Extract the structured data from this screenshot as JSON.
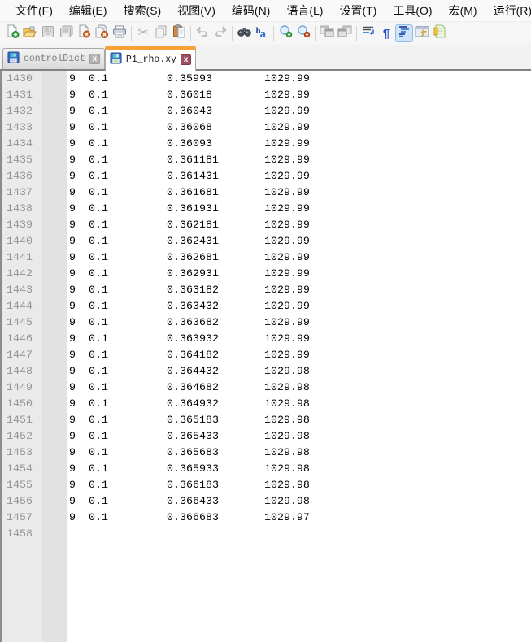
{
  "menu": {
    "items": [
      "文件(F)",
      "编辑(E)",
      "搜索(S)",
      "视图(V)",
      "编码(N)",
      "语言(L)",
      "设置(T)",
      "工具(O)",
      "宏(M)",
      "运行(R)"
    ]
  },
  "toolbar": {
    "icons": [
      {
        "name": "new-file-icon",
        "enabled": true
      },
      {
        "name": "open-file-icon",
        "enabled": true
      },
      {
        "name": "save-icon",
        "enabled": false
      },
      {
        "name": "save-all-icon",
        "enabled": false
      },
      {
        "name": "close-file-icon",
        "enabled": true
      },
      {
        "name": "close-all-icon",
        "enabled": true
      },
      {
        "name": "print-icon",
        "enabled": true
      },
      {
        "name": "cut-icon",
        "enabled": false
      },
      {
        "name": "copy-icon",
        "enabled": false
      },
      {
        "name": "paste-icon",
        "enabled": true
      },
      {
        "name": "undo-icon",
        "enabled": false
      },
      {
        "name": "redo-icon",
        "enabled": false
      },
      {
        "name": "find-icon",
        "enabled": true
      },
      {
        "name": "replace-icon",
        "enabled": true
      },
      {
        "name": "zoom-in-icon",
        "enabled": true
      },
      {
        "name": "zoom-out-icon",
        "enabled": true
      },
      {
        "name": "sync-vertical-scroll-icon",
        "enabled": false
      },
      {
        "name": "sync-horizontal-scroll-icon",
        "enabled": false
      },
      {
        "name": "word-wrap-icon",
        "enabled": true
      },
      {
        "name": "show-all-characters-icon",
        "enabled": true
      },
      {
        "name": "show-indent-guide-icon",
        "enabled": true,
        "active": true
      },
      {
        "name": "user-defined-dialog-icon",
        "enabled": true
      },
      {
        "name": "document-map-icon",
        "enabled": true,
        "clipped": true
      }
    ],
    "pilcrow_glyph": "¶",
    "cut_glyph": "✂",
    "replace_glyph_small": "h",
    "replace_glyph_big": "a"
  },
  "tabs": [
    {
      "title": "controlDict",
      "active": false,
      "saved": true,
      "close_label": "x"
    },
    {
      "title": "P1_rho.xy",
      "active": true,
      "saved": true,
      "close_label": "x"
    }
  ],
  "colors": {
    "active_tab_accent": "#f9a233",
    "active_close_bg": "#9e4f63",
    "inactive_close_bg": "#b5b5b5",
    "toolbar_active_bg": "#cfe5f7",
    "gutter_bg": "#eaeaea",
    "line_number_color": "#949494"
  },
  "editor": {
    "lines": [
      {
        "n": "1430",
        "c": [
          "9",
          "0.1",
          "0.35993",
          "1029.99"
        ]
      },
      {
        "n": "1431",
        "c": [
          "9",
          "0.1",
          "0.36018",
          "1029.99"
        ]
      },
      {
        "n": "1432",
        "c": [
          "9",
          "0.1",
          "0.36043",
          "1029.99"
        ]
      },
      {
        "n": "1433",
        "c": [
          "9",
          "0.1",
          "0.36068",
          "1029.99"
        ]
      },
      {
        "n": "1434",
        "c": [
          "9",
          "0.1",
          "0.36093",
          "1029.99"
        ]
      },
      {
        "n": "1435",
        "c": [
          "9",
          "0.1",
          "0.361181",
          "1029.99"
        ]
      },
      {
        "n": "1436",
        "c": [
          "9",
          "0.1",
          "0.361431",
          "1029.99"
        ]
      },
      {
        "n": "1437",
        "c": [
          "9",
          "0.1",
          "0.361681",
          "1029.99"
        ]
      },
      {
        "n": "1438",
        "c": [
          "9",
          "0.1",
          "0.361931",
          "1029.99"
        ]
      },
      {
        "n": "1439",
        "c": [
          "9",
          "0.1",
          "0.362181",
          "1029.99"
        ]
      },
      {
        "n": "1440",
        "c": [
          "9",
          "0.1",
          "0.362431",
          "1029.99"
        ]
      },
      {
        "n": "1441",
        "c": [
          "9",
          "0.1",
          "0.362681",
          "1029.99"
        ]
      },
      {
        "n": "1442",
        "c": [
          "9",
          "0.1",
          "0.362931",
          "1029.99"
        ]
      },
      {
        "n": "1443",
        "c": [
          "9",
          "0.1",
          "0.363182",
          "1029.99"
        ]
      },
      {
        "n": "1444",
        "c": [
          "9",
          "0.1",
          "0.363432",
          "1029.99"
        ]
      },
      {
        "n": "1445",
        "c": [
          "9",
          "0.1",
          "0.363682",
          "1029.99"
        ]
      },
      {
        "n": "1446",
        "c": [
          "9",
          "0.1",
          "0.363932",
          "1029.99"
        ]
      },
      {
        "n": "1447",
        "c": [
          "9",
          "0.1",
          "0.364182",
          "1029.99"
        ]
      },
      {
        "n": "1448",
        "c": [
          "9",
          "0.1",
          "0.364432",
          "1029.98"
        ]
      },
      {
        "n": "1449",
        "c": [
          "9",
          "0.1",
          "0.364682",
          "1029.98"
        ]
      },
      {
        "n": "1450",
        "c": [
          "9",
          "0.1",
          "0.364932",
          "1029.98"
        ]
      },
      {
        "n": "1451",
        "c": [
          "9",
          "0.1",
          "0.365183",
          "1029.98"
        ]
      },
      {
        "n": "1452",
        "c": [
          "9",
          "0.1",
          "0.365433",
          "1029.98"
        ]
      },
      {
        "n": "1453",
        "c": [
          "9",
          "0.1",
          "0.365683",
          "1029.98"
        ]
      },
      {
        "n": "1454",
        "c": [
          "9",
          "0.1",
          "0.365933",
          "1029.98"
        ]
      },
      {
        "n": "1455",
        "c": [
          "9",
          "0.1",
          "0.366183",
          "1029.98"
        ]
      },
      {
        "n": "1456",
        "c": [
          "9",
          "0.1",
          "0.366433",
          "1029.98"
        ]
      },
      {
        "n": "1457",
        "c": [
          "9",
          "0.1",
          "0.366683",
          "1029.97"
        ]
      },
      {
        "n": "1458",
        "c": []
      }
    ]
  }
}
